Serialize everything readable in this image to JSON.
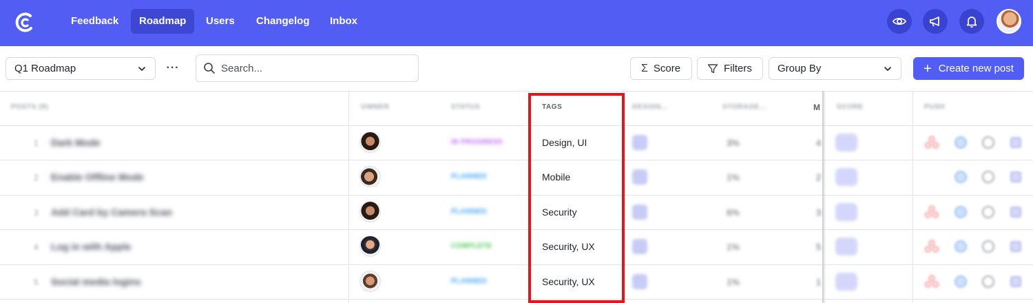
{
  "nav": {
    "items": [
      {
        "label": "Feedback",
        "active": false
      },
      {
        "label": "Roadmap",
        "active": true
      },
      {
        "label": "Users",
        "active": false
      },
      {
        "label": "Changelog",
        "active": false
      },
      {
        "label": "Inbox",
        "active": false
      }
    ],
    "icons": [
      "eye-icon",
      "megaphone-icon",
      "bell-icon"
    ],
    "brand_color": "#525df4"
  },
  "toolbar": {
    "roadmap_select": "Q1 Roadmap",
    "more": "···",
    "search_placeholder": "Search...",
    "score_label": "Score",
    "filters_label": "Filters",
    "group_by": "Group By",
    "create_label": "Create new post"
  },
  "table": {
    "headers": {
      "posts": "POSTS (8)",
      "owner": "OWNER",
      "status": "STATUS",
      "tags": "TAGS",
      "design": "DESIGN...",
      "storage": "STORAGE...",
      "m": "M",
      "score": "SCORE",
      "push": "PUSH"
    },
    "rows": [
      {
        "num": "1",
        "title": "Dark Mode",
        "status": "IN PROGRESS",
        "status_color": "#b45cf0",
        "tags": "Design, UI",
        "pct": "3%",
        "m": "4",
        "score": "75"
      },
      {
        "num": "2",
        "title": "Enable Offline Mode",
        "status": "PLANNED",
        "status_color": "#2f9cf4",
        "tags": "Mobile",
        "pct": "1%",
        "m": "2",
        "score": "4.5"
      },
      {
        "num": "3",
        "title": "Add Card by Camera Scan",
        "status": "PLANNED",
        "status_color": "#2f9cf4",
        "tags": "Security",
        "pct": "6%",
        "m": "3",
        "score": "30"
      },
      {
        "num": "4",
        "title": "Log in with Apple",
        "status": "COMPLETE",
        "status_color": "#3cc24a",
        "tags": "Security, UX",
        "pct": "1%",
        "m": "5",
        "score": "6.7"
      },
      {
        "num": "5",
        "title": "Social media logins",
        "status": "PLANNED",
        "status_color": "#2f9cf4",
        "tags": "Security, UX",
        "pct": "1%",
        "m": "1",
        "score": "7.8"
      }
    ]
  }
}
